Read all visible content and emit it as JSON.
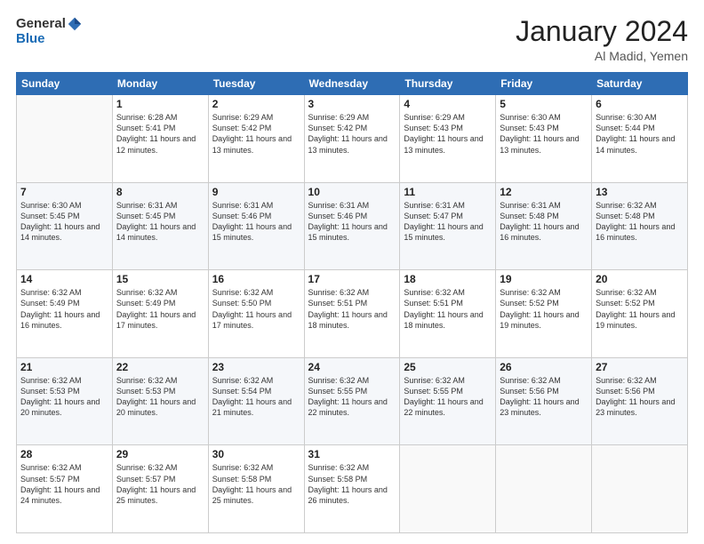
{
  "logo": {
    "general": "General",
    "blue": "Blue"
  },
  "title": {
    "month_year": "January 2024",
    "location": "Al Madid, Yemen"
  },
  "headers": [
    "Sunday",
    "Monday",
    "Tuesday",
    "Wednesday",
    "Thursday",
    "Friday",
    "Saturday"
  ],
  "weeks": [
    [
      {
        "day": "",
        "sunrise": "",
        "sunset": "",
        "daylight": ""
      },
      {
        "day": "1",
        "sunrise": "Sunrise: 6:28 AM",
        "sunset": "Sunset: 5:41 PM",
        "daylight": "Daylight: 11 hours and 12 minutes."
      },
      {
        "day": "2",
        "sunrise": "Sunrise: 6:29 AM",
        "sunset": "Sunset: 5:42 PM",
        "daylight": "Daylight: 11 hours and 13 minutes."
      },
      {
        "day": "3",
        "sunrise": "Sunrise: 6:29 AM",
        "sunset": "Sunset: 5:42 PM",
        "daylight": "Daylight: 11 hours and 13 minutes."
      },
      {
        "day": "4",
        "sunrise": "Sunrise: 6:29 AM",
        "sunset": "Sunset: 5:43 PM",
        "daylight": "Daylight: 11 hours and 13 minutes."
      },
      {
        "day": "5",
        "sunrise": "Sunrise: 6:30 AM",
        "sunset": "Sunset: 5:43 PM",
        "daylight": "Daylight: 11 hours and 13 minutes."
      },
      {
        "day": "6",
        "sunrise": "Sunrise: 6:30 AM",
        "sunset": "Sunset: 5:44 PM",
        "daylight": "Daylight: 11 hours and 14 minutes."
      }
    ],
    [
      {
        "day": "7",
        "sunrise": "Sunrise: 6:30 AM",
        "sunset": "Sunset: 5:45 PM",
        "daylight": "Daylight: 11 hours and 14 minutes."
      },
      {
        "day": "8",
        "sunrise": "Sunrise: 6:31 AM",
        "sunset": "Sunset: 5:45 PM",
        "daylight": "Daylight: 11 hours and 14 minutes."
      },
      {
        "day": "9",
        "sunrise": "Sunrise: 6:31 AM",
        "sunset": "Sunset: 5:46 PM",
        "daylight": "Daylight: 11 hours and 15 minutes."
      },
      {
        "day": "10",
        "sunrise": "Sunrise: 6:31 AM",
        "sunset": "Sunset: 5:46 PM",
        "daylight": "Daylight: 11 hours and 15 minutes."
      },
      {
        "day": "11",
        "sunrise": "Sunrise: 6:31 AM",
        "sunset": "Sunset: 5:47 PM",
        "daylight": "Daylight: 11 hours and 15 minutes."
      },
      {
        "day": "12",
        "sunrise": "Sunrise: 6:31 AM",
        "sunset": "Sunset: 5:48 PM",
        "daylight": "Daylight: 11 hours and 16 minutes."
      },
      {
        "day": "13",
        "sunrise": "Sunrise: 6:32 AM",
        "sunset": "Sunset: 5:48 PM",
        "daylight": "Daylight: 11 hours and 16 minutes."
      }
    ],
    [
      {
        "day": "14",
        "sunrise": "Sunrise: 6:32 AM",
        "sunset": "Sunset: 5:49 PM",
        "daylight": "Daylight: 11 hours and 16 minutes."
      },
      {
        "day": "15",
        "sunrise": "Sunrise: 6:32 AM",
        "sunset": "Sunset: 5:49 PM",
        "daylight": "Daylight: 11 hours and 17 minutes."
      },
      {
        "day": "16",
        "sunrise": "Sunrise: 6:32 AM",
        "sunset": "Sunset: 5:50 PM",
        "daylight": "Daylight: 11 hours and 17 minutes."
      },
      {
        "day": "17",
        "sunrise": "Sunrise: 6:32 AM",
        "sunset": "Sunset: 5:51 PM",
        "daylight": "Daylight: 11 hours and 18 minutes."
      },
      {
        "day": "18",
        "sunrise": "Sunrise: 6:32 AM",
        "sunset": "Sunset: 5:51 PM",
        "daylight": "Daylight: 11 hours and 18 minutes."
      },
      {
        "day": "19",
        "sunrise": "Sunrise: 6:32 AM",
        "sunset": "Sunset: 5:52 PM",
        "daylight": "Daylight: 11 hours and 19 minutes."
      },
      {
        "day": "20",
        "sunrise": "Sunrise: 6:32 AM",
        "sunset": "Sunset: 5:52 PM",
        "daylight": "Daylight: 11 hours and 19 minutes."
      }
    ],
    [
      {
        "day": "21",
        "sunrise": "Sunrise: 6:32 AM",
        "sunset": "Sunset: 5:53 PM",
        "daylight": "Daylight: 11 hours and 20 minutes."
      },
      {
        "day": "22",
        "sunrise": "Sunrise: 6:32 AM",
        "sunset": "Sunset: 5:53 PM",
        "daylight": "Daylight: 11 hours and 20 minutes."
      },
      {
        "day": "23",
        "sunrise": "Sunrise: 6:32 AM",
        "sunset": "Sunset: 5:54 PM",
        "daylight": "Daylight: 11 hours and 21 minutes."
      },
      {
        "day": "24",
        "sunrise": "Sunrise: 6:32 AM",
        "sunset": "Sunset: 5:55 PM",
        "daylight": "Daylight: 11 hours and 22 minutes."
      },
      {
        "day": "25",
        "sunrise": "Sunrise: 6:32 AM",
        "sunset": "Sunset: 5:55 PM",
        "daylight": "Daylight: 11 hours and 22 minutes."
      },
      {
        "day": "26",
        "sunrise": "Sunrise: 6:32 AM",
        "sunset": "Sunset: 5:56 PM",
        "daylight": "Daylight: 11 hours and 23 minutes."
      },
      {
        "day": "27",
        "sunrise": "Sunrise: 6:32 AM",
        "sunset": "Sunset: 5:56 PM",
        "daylight": "Daylight: 11 hours and 23 minutes."
      }
    ],
    [
      {
        "day": "28",
        "sunrise": "Sunrise: 6:32 AM",
        "sunset": "Sunset: 5:57 PM",
        "daylight": "Daylight: 11 hours and 24 minutes."
      },
      {
        "day": "29",
        "sunrise": "Sunrise: 6:32 AM",
        "sunset": "Sunset: 5:57 PM",
        "daylight": "Daylight: 11 hours and 25 minutes."
      },
      {
        "day": "30",
        "sunrise": "Sunrise: 6:32 AM",
        "sunset": "Sunset: 5:58 PM",
        "daylight": "Daylight: 11 hours and 25 minutes."
      },
      {
        "day": "31",
        "sunrise": "Sunrise: 6:32 AM",
        "sunset": "Sunset: 5:58 PM",
        "daylight": "Daylight: 11 hours and 26 minutes."
      },
      {
        "day": "",
        "sunrise": "",
        "sunset": "",
        "daylight": ""
      },
      {
        "day": "",
        "sunrise": "",
        "sunset": "",
        "daylight": ""
      },
      {
        "day": "",
        "sunrise": "",
        "sunset": "",
        "daylight": ""
      }
    ]
  ]
}
